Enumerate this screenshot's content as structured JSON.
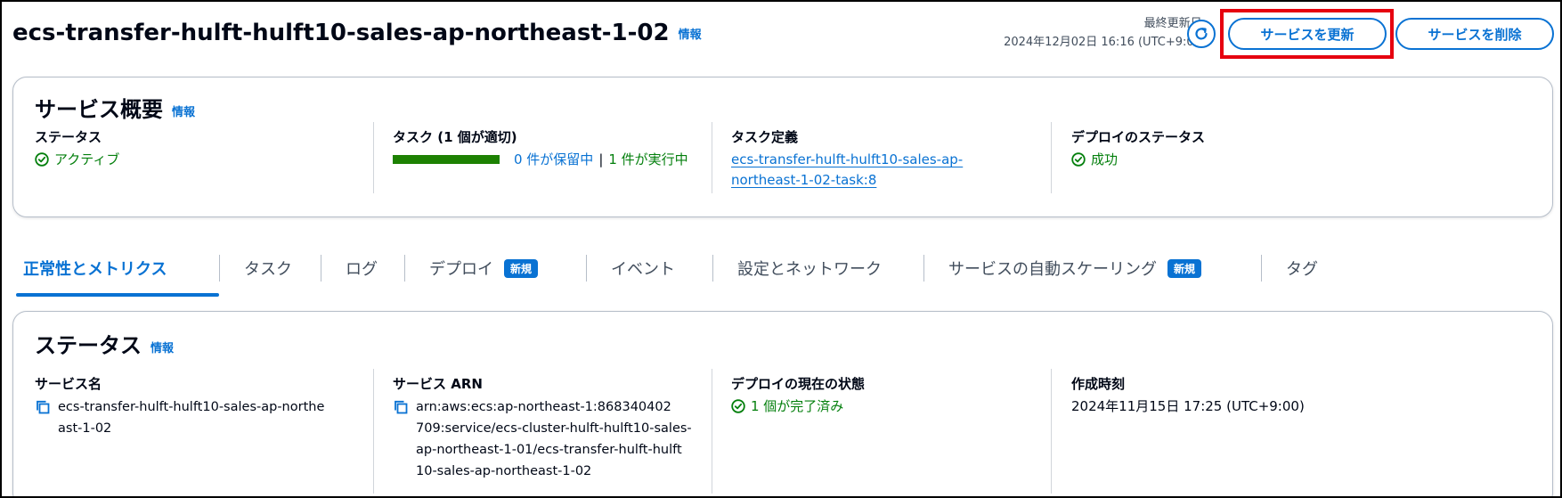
{
  "header": {
    "title": "ecs-transfer-hulft-hulft10-sales-ap-northeast-1-02",
    "info_label": "情報",
    "last_updated_label": "最終更新日:",
    "last_updated_value": "2024年12月02日 16:16 (UTC+9:00)",
    "update_button": "サービスを更新",
    "delete_button": "サービスを削除"
  },
  "overview": {
    "title": "サービス概要",
    "info_label": "情報",
    "status_label": "ステータス",
    "status_value": "アクティブ",
    "tasks_label": "タスク (1 個が適切)",
    "tasks_pending": "0 件が保留中",
    "tasks_separator": "|",
    "tasks_running": "1 件が実行中",
    "tasks_running_fraction": 1.0,
    "task_def_label": "タスク定義",
    "task_def_line1": "ecs-transfer-hulft-hulft10-sales-ap-",
    "task_def_line2": "northeast-1-02-task:8",
    "deploy_status_label": "デプロイのステータス",
    "deploy_status_value": "成功"
  },
  "tabs": [
    {
      "label": "正常性とメトリクス",
      "active": true
    },
    {
      "label": "タスク"
    },
    {
      "label": "ログ"
    },
    {
      "label": "デプロイ",
      "badge": "新規"
    },
    {
      "label": "イベント"
    },
    {
      "label": "設定とネットワーク"
    },
    {
      "label": "サービスの自動スケーリング",
      "badge": "新規"
    },
    {
      "label": "タグ"
    }
  ],
  "status": {
    "title": "ステータス",
    "info_label": "情報",
    "service_name_label": "サービス名",
    "service_name_line1": "ecs-transfer-hulft-hulft10-sales-ap-northe",
    "service_name_line2": "ast-1-02",
    "arn_label": "サービス ARN",
    "arn_line1": "arn:aws:ecs:ap-northeast-1:868340402",
    "arn_line2": "709:service/ecs-cluster-hulft-hulft10-sales-",
    "arn_line3": "ap-northeast-1-01/ecs-transfer-hulft-hulft",
    "arn_line4": "10-sales-ap-northeast-1-02",
    "deploy_state_label": "デプロイの現在の状態",
    "deploy_state_value": "1 個が完了済み",
    "created_label": "作成時刻",
    "created_value": "2024年11月15日 17:25 (UTC+9:00)"
  },
  "colors": {
    "accent": "#0972d3",
    "success": "#037f0c",
    "highlight": "#e6000f"
  }
}
